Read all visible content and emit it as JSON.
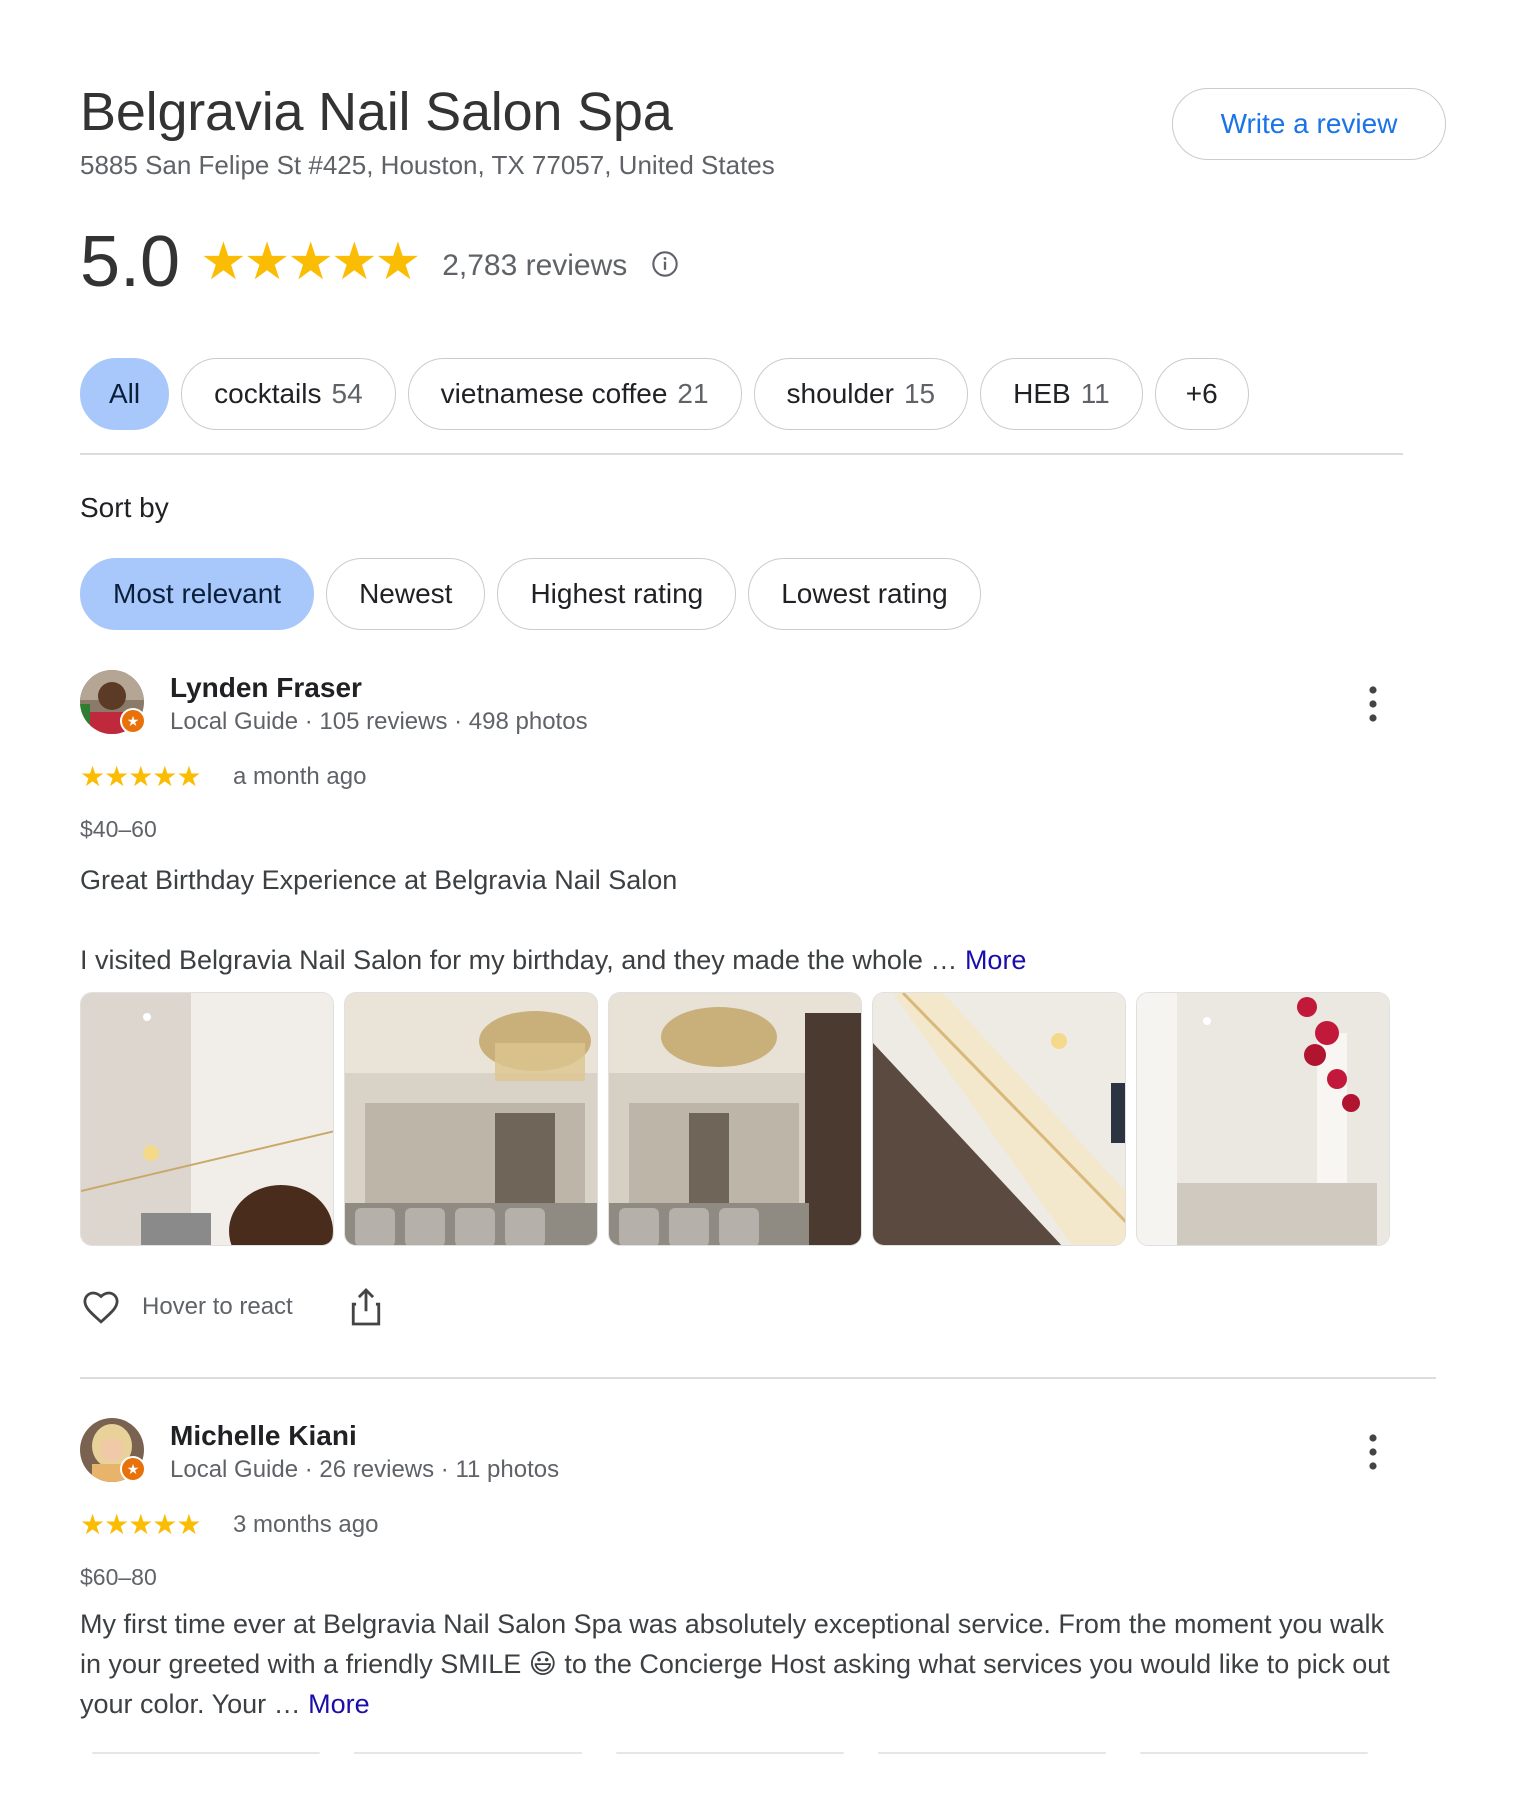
{
  "place": {
    "name": "Belgravia Nail Salon Spa",
    "address": "5885 San Felipe St #425, Houston, TX 77057, United States",
    "write_review_label": "Write a review"
  },
  "summary": {
    "rating": "5.0",
    "stars": "★★★★★",
    "review_count": "2,783 reviews",
    "rating_value": 5.0
  },
  "topics": [
    {
      "label": "All",
      "count": "",
      "active": true
    },
    {
      "label": "cocktails",
      "count": "54"
    },
    {
      "label": "vietnamese coffee",
      "count": "21"
    },
    {
      "label": "shoulder",
      "count": "15"
    },
    {
      "label": "HEB",
      "count": "11"
    },
    {
      "label": "+6",
      "count": ""
    }
  ],
  "sort": {
    "label": "Sort by",
    "options": [
      "Most relevant",
      "Newest",
      "Highest rating",
      "Lowest rating"
    ],
    "selected": "Most relevant"
  },
  "reviews": [
    {
      "author": "Lynden Fraser",
      "meta": "Local Guide · 105 reviews · 498 photos",
      "stars": "★★★★★",
      "rating": 5,
      "time": "a month ago",
      "price": "$40–60",
      "text_title": "Great Birthday Experience at Belgravia Nail Salon",
      "text_body": "I visited Belgravia Nail Salon for my birthday, and they made the whole … ",
      "more_label": "More",
      "react_label": "Hover to react"
    },
    {
      "author": "Michelle Kiani",
      "meta": "Local Guide · 26 reviews · 11 photos",
      "stars": "★★★★★",
      "rating": 5,
      "time": "3 months ago",
      "price": "$60–80",
      "text_body": "My first time ever at Belgravia Nail Salon Spa was absolutely exceptional service. From the moment you walk in your greeted with a friendly SMILE 😃 to the Concierge Host asking what services you would like to pick out your color. Your … ",
      "more_label": "More"
    }
  ],
  "colors": {
    "star": "#fbbc04",
    "accent_blue": "#1a73e8",
    "chip_active": "#a8c7fa",
    "link": "#1a0dab",
    "guide_badge": "#e8710a"
  },
  "icons": [
    "info-icon",
    "more-vert-icon",
    "heart-icon",
    "share-icon",
    "local-guide-badge-icon"
  ]
}
